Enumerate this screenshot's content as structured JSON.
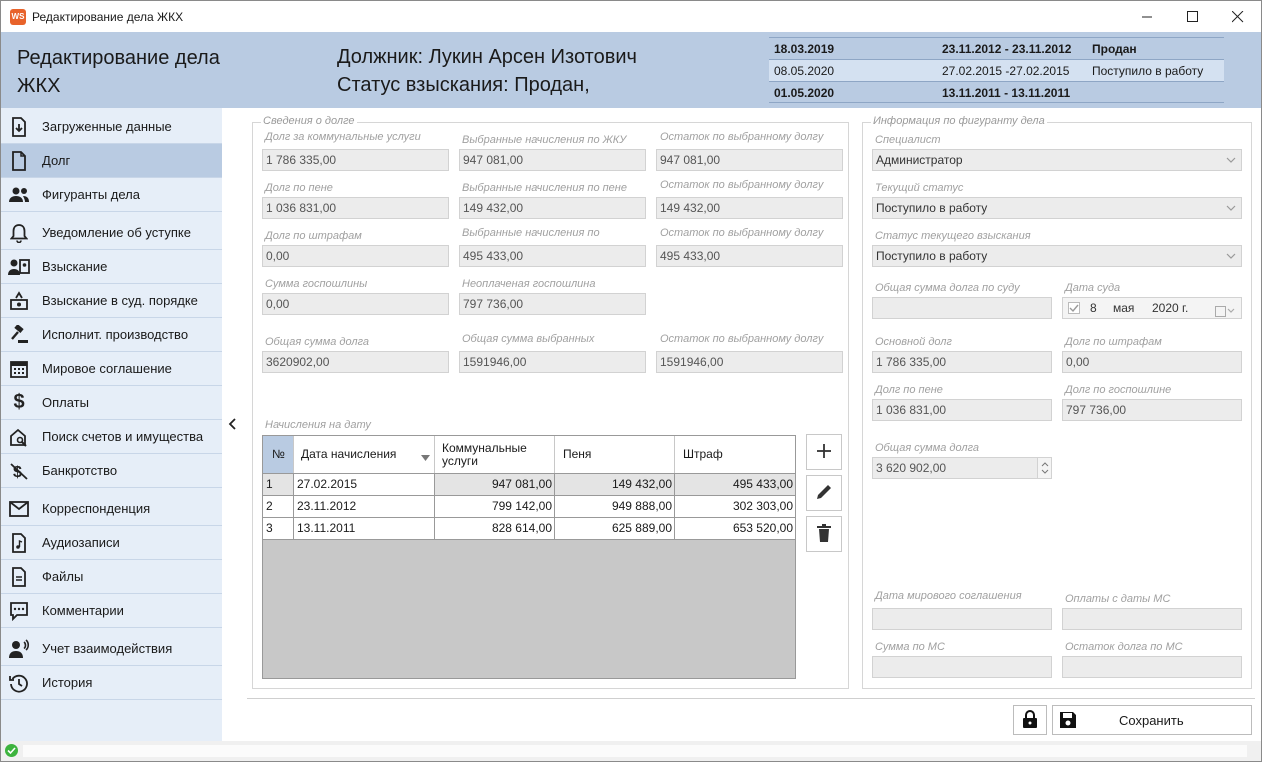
{
  "window": {
    "title": "Редактирование дела ЖКХ",
    "app_badge": "WS"
  },
  "header": {
    "title": "Редактирование дела ЖКХ",
    "debtor": "Должник: Лукин Арсен Изотович",
    "status": "Статус взыскания: Продан,",
    "history": [
      {
        "date": "18.03.2019",
        "period": "23.11.2012 - 23.11.2012",
        "state": "Продан",
        "bold": true
      },
      {
        "date": "08.05.2020",
        "period": "27.02.2015 -27.02.2015",
        "state": "Поступило в работу",
        "bold": false
      },
      {
        "date": "01.05.2020",
        "period": "13.11.2011 - 13.11.2011",
        "state": "",
        "bold": true
      }
    ]
  },
  "sidebar": {
    "items": [
      {
        "label": "Загруженные данные",
        "icon": "download-document-icon"
      },
      {
        "label": "Долг",
        "icon": "document-icon"
      },
      {
        "label": "Фигуранты дела",
        "icon": "people-icon"
      },
      {
        "label": "Уведомление об уступке",
        "icon": "bell-icon"
      },
      {
        "label": "Взыскание",
        "icon": "person-card-icon"
      },
      {
        "label": "Взыскание в суд. порядке",
        "icon": "court-money-icon"
      },
      {
        "label": "Исполнит. производство",
        "icon": "gavel-icon"
      },
      {
        "label": "Мировое соглашение",
        "icon": "calendar-icon"
      },
      {
        "label": "Оплаты",
        "icon": "dollar-icon"
      },
      {
        "label": "Поиск счетов и имущества",
        "icon": "house-search-icon"
      },
      {
        "label": "Банкротство",
        "icon": "no-money-icon"
      },
      {
        "label": "Корреспонденция",
        "icon": "envelope-icon"
      },
      {
        "label": "Аудиозаписи",
        "icon": "audio-file-icon"
      },
      {
        "label": "Файлы",
        "icon": "file-icon"
      },
      {
        "label": "Комментарии",
        "icon": "comment-icon"
      },
      {
        "label": "Учет взаимодействия",
        "icon": "call-person-icon"
      },
      {
        "label": "История",
        "icon": "history-icon"
      }
    ],
    "selected": "Долг"
  },
  "debt": {
    "group_title": "Сведения о долге",
    "fields": {
      "utility_debt": {
        "label": "Долг за коммунальные услуги",
        "value": "1 786 335,00"
      },
      "sel_housing": {
        "label": "Выбранные начисления по ЖКУ",
        "value": "947 081,00"
      },
      "rem1": {
        "label": "Остаток по выбранному долгу",
        "value": "947 081,00"
      },
      "penalty_debt": {
        "label": "Долг по пене",
        "value": "1 036 831,00"
      },
      "sel_penalty": {
        "label": "Выбранные начисления по пене",
        "value": "149 432,00"
      },
      "rem2": {
        "label": "Остаток по выбранному долгу",
        "value": "149 432,00"
      },
      "fine_debt": {
        "label": "Долг по штрафам",
        "value": "0,00"
      },
      "sel_fine": {
        "label": "Выбранные начисления по",
        "value": "495 433,00"
      },
      "rem3": {
        "label": "Остаток по выбранному долгу",
        "value": "495 433,00"
      },
      "fee_sum": {
        "label": "Сумма госпошлины",
        "value": "0,00"
      },
      "unpaid_fee": {
        "label": "Неоплаченая госпошлина",
        "value": "797 736,00"
      },
      "total_debt": {
        "label": "Общая сумма долга",
        "value": "3620902,00"
      },
      "total_selected": {
        "label": "Общая сумма выбранных",
        "value": "1591946,00"
      },
      "rem4": {
        "label": "Остаток по выбранному долгу",
        "value": "1591946,00"
      }
    },
    "charges_label": "Начисления на дату",
    "table": {
      "columns": [
        "№",
        "Дата начисления",
        "Коммунальные услуги",
        "Пеня",
        "Штраф"
      ],
      "rows": [
        {
          "n": "1",
          "date": "27.02.2015",
          "utility": "947 081,00",
          "penalty": "149 432,00",
          "fine": "495 433,00"
        },
        {
          "n": "2",
          "date": "23.11.2012",
          "utility": "799 142,00",
          "penalty": "949 888,00",
          "fine": "302 303,00"
        },
        {
          "n": "3",
          "date": "13.11.2011",
          "utility": "828 614,00",
          "penalty": "625 889,00",
          "fine": "653 520,00"
        }
      ]
    }
  },
  "figurant": {
    "group_title": "Информация по фигуранту дела",
    "specialist": {
      "label": "Специалист",
      "value": "Администратор"
    },
    "current_status": {
      "label": "Текущий статус",
      "value": "Поступило в работу"
    },
    "recovery_status": {
      "label": "Статус текущего взыскания",
      "value": "Поступило в работу"
    },
    "court_total": {
      "label": "Общая сумма долга по суду",
      "value": ""
    },
    "court_date": {
      "label": "Дата суда",
      "day": "8",
      "month": "мая",
      "year": "2020 г."
    },
    "main_debt": {
      "label": "Основной долг",
      "value": "1 786 335,00"
    },
    "fine_debt": {
      "label": "Долг по штрафам",
      "value": "0,00"
    },
    "penalty_debt": {
      "label": "Долг по пене",
      "value": "1 036 831,00"
    },
    "fee_debt": {
      "label": "Долг по госпошлине",
      "value": "797 736,00"
    },
    "total_debt": {
      "label": "Общая сумма долга",
      "value": "3 620 902,00"
    },
    "ms_date": {
      "label": "Дата мирового соглашения",
      "value": ""
    },
    "ms_payments": {
      "label": "Оплаты с даты МС",
      "value": ""
    },
    "ms_sum": {
      "label": "Сумма по МС",
      "value": ""
    },
    "ms_remaining": {
      "label": "Остаток долга по МС",
      "value": ""
    }
  },
  "actions": {
    "save": "Сохранить"
  },
  "colors": {
    "header_bg": "#b9cbe2",
    "sidebar_bg": "#e6eef8",
    "accent": "#e8632b",
    "ok": "#3db33d"
  }
}
